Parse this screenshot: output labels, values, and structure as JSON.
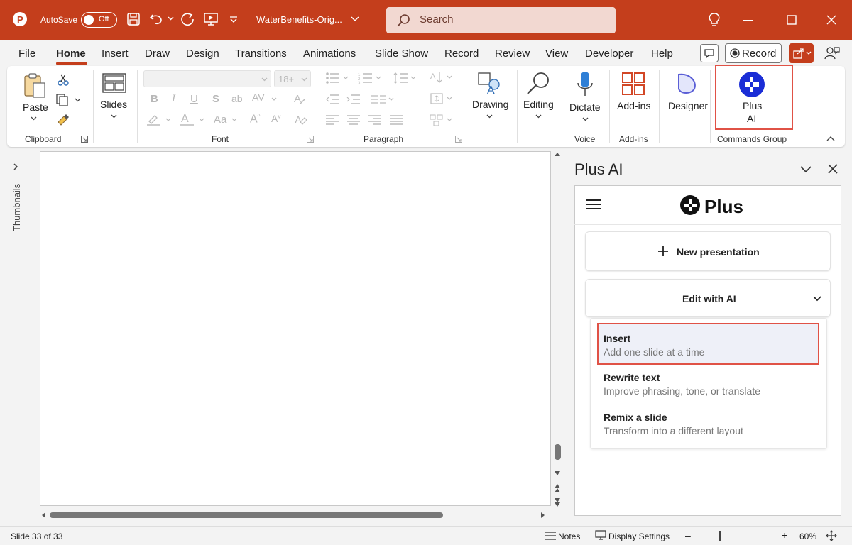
{
  "titlebar": {
    "autosave_label": "AutoSave",
    "autosave_state": "Off",
    "document_title": "WaterBenefits-Orig...",
    "search_placeholder": "Search"
  },
  "menu": {
    "items": [
      "File",
      "Home",
      "Insert",
      "Draw",
      "Design",
      "Transitions",
      "Animations",
      "Slide Show",
      "Record",
      "Review",
      "View",
      "Developer",
      "Help"
    ],
    "active": "Home",
    "record_label": "Record"
  },
  "ribbon": {
    "clipboard": {
      "paste_label": "Paste",
      "group_label": "Clipboard"
    },
    "slides": {
      "label": "Slides"
    },
    "font": {
      "size_placeholder": "18+",
      "group_label": "Font"
    },
    "paragraph": {
      "group_label": "Paragraph"
    },
    "drawing": {
      "label": "Drawing"
    },
    "editing": {
      "label": "Editing"
    },
    "voice": {
      "dictate_label": "Dictate",
      "group_label": "Voice"
    },
    "addins": {
      "label": "Add-ins",
      "group_label": "Add-ins"
    },
    "designer": {
      "label": "Designer"
    },
    "plusai": {
      "label_line1": "Plus",
      "label_line2": "AI",
      "group_label": "Commands Group"
    }
  },
  "thumbnails": {
    "label": "Thumbnails"
  },
  "pane": {
    "title": "Plus AI",
    "logo_text": "Plus",
    "new_presentation": "New presentation",
    "edit_with_ai": "Edit with AI",
    "options": [
      {
        "title": "Insert",
        "subtitle": "Add one slide at a time"
      },
      {
        "title": "Rewrite text",
        "subtitle": "Improve phrasing, tone, or translate"
      },
      {
        "title": "Remix a slide",
        "subtitle": "Transform into a different layout"
      }
    ]
  },
  "statusbar": {
    "slide_info": "Slide 33 of 33",
    "notes_label": "Notes",
    "display_settings_label": "Display Settings",
    "zoom_minus": "–",
    "zoom_plus": "+",
    "zoom_level": "60%"
  },
  "colors": {
    "accent": "#c43e1c",
    "highlight": "#e05246",
    "plus_logo": "#1a2dd6"
  }
}
